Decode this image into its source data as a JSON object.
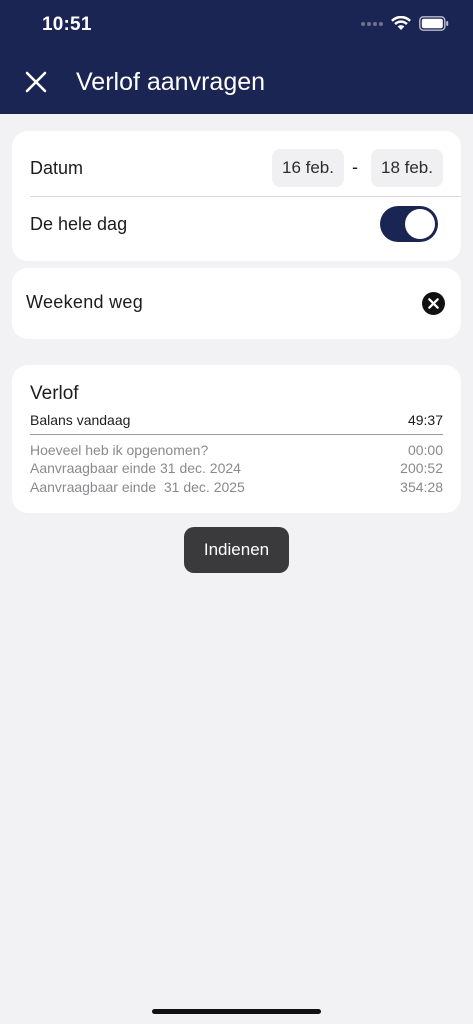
{
  "status_bar": {
    "time": "10:51"
  },
  "header": {
    "title": "Verlof aanvragen"
  },
  "date_card": {
    "date_label": "Datum",
    "start_date": "16 feb.",
    "separator": "-",
    "end_date": "18 feb.",
    "whole_day_label": "De hele dag",
    "whole_day_on": true
  },
  "note": {
    "value": "Weekend weg"
  },
  "leave": {
    "title": "Verlof",
    "balance_label": "Balans vandaag",
    "balance_value": "49:37",
    "rows": [
      {
        "label": "Hoeveel heb ik opgenomen?",
        "value": "00:00"
      },
      {
        "label": "Aanvraagbaar einde 31 dec. 2024",
        "value": "200:52"
      },
      {
        "label": "Aanvraagbaar einde  31 dec. 2025",
        "value": "354:28"
      }
    ]
  },
  "submit": {
    "label": "Indienen"
  },
  "colors": {
    "header_bg": "#1b2553",
    "page_bg": "#f2f2f4",
    "toggle_on": "#1b2553",
    "submit_bg": "#3a3a3c"
  }
}
